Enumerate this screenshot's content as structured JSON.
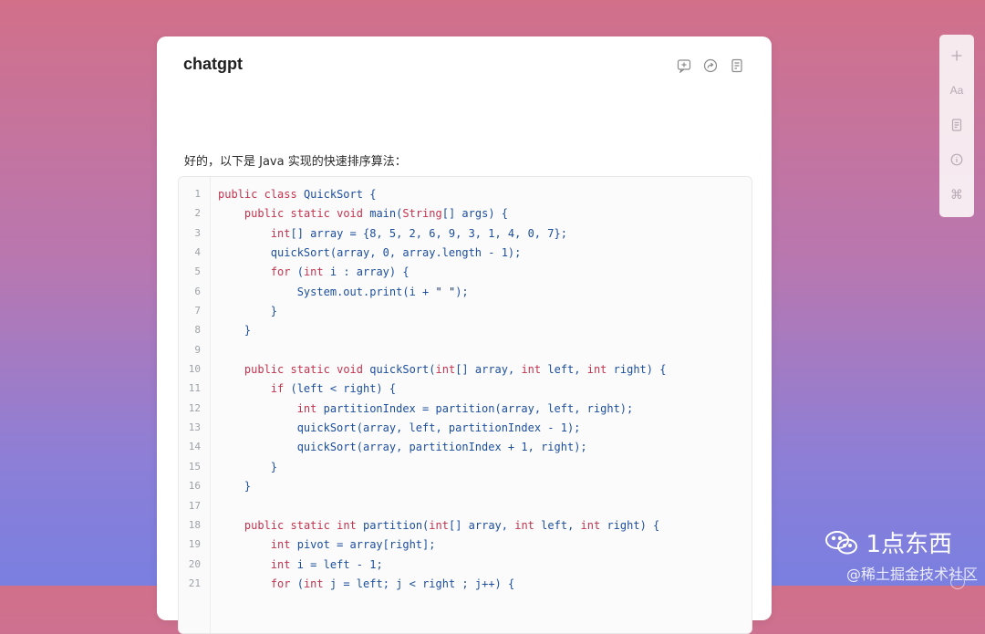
{
  "conversation": {
    "title": "chatgpt",
    "intro": "好的，以下是 Java 实现的快速排序算法：",
    "header_actions": [
      {
        "name": "comment-icon"
      },
      {
        "name": "share-icon"
      },
      {
        "name": "document-icon"
      }
    ]
  },
  "code": {
    "language": "java",
    "lines": [
      {
        "n": "1",
        "t": "public class QuickSort {"
      },
      {
        "n": "2",
        "t": "    public static void main(String[] args) {"
      },
      {
        "n": "3",
        "t": "        int[] array = {8, 5, 2, 6, 9, 3, 1, 4, 0, 7};"
      },
      {
        "n": "4",
        "t": "        quickSort(array, 0, array.length - 1);"
      },
      {
        "n": "5",
        "t": "        for (int i : array) {"
      },
      {
        "n": "6",
        "t": "            System.out.print(i + \" \");"
      },
      {
        "n": "7",
        "t": "        }"
      },
      {
        "n": "8",
        "t": "    }"
      },
      {
        "n": "9",
        "t": ""
      },
      {
        "n": "10",
        "t": "    public static void quickSort(int[] array, int left, int right) {"
      },
      {
        "n": "11",
        "t": "        if (left < right) {"
      },
      {
        "n": "12",
        "t": "            int partitionIndex = partition(array, left, right);"
      },
      {
        "n": "13",
        "t": "            quickSort(array, left, partitionIndex - 1);"
      },
      {
        "n": "14",
        "t": "            quickSort(array, partitionIndex + 1, right);"
      },
      {
        "n": "15",
        "t": "        }"
      },
      {
        "n": "16",
        "t": "    }"
      },
      {
        "n": "17",
        "t": ""
      },
      {
        "n": "18",
        "t": "    public static int partition(int[] array, int left, int right) {"
      },
      {
        "n": "19",
        "t": "        int pivot = array[right];"
      },
      {
        "n": "20",
        "t": "        int i = left - 1;"
      },
      {
        "n": "21",
        "t": "        for (int j = left; j < right ; j++) {"
      }
    ]
  },
  "side_rail": {
    "items": [
      {
        "name": "plus-icon",
        "label": "+"
      },
      {
        "name": "font-size-icon",
        "label": "Aa"
      },
      {
        "name": "document-icon",
        "label": ""
      },
      {
        "name": "info-icon",
        "label": ""
      },
      {
        "name": "command-icon",
        "label": "⌘"
      }
    ]
  },
  "watermark": {
    "brand": "1点东西",
    "credit": "@稀土掘金技术社区",
    "icon": "wechat-icon"
  }
}
